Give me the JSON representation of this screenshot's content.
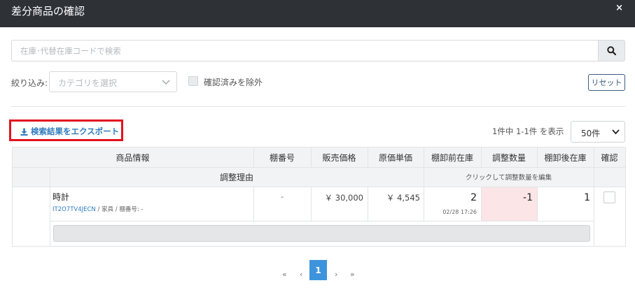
{
  "modal": {
    "title": "差分商品の確認",
    "close_label": "×"
  },
  "search": {
    "placeholder": "在庫･代替在庫コードで検索",
    "value": ""
  },
  "filter": {
    "label": "絞り込み:",
    "category_placeholder": "カテゴリを選択",
    "exclude_confirmed_label": "確認済みを除外",
    "reset_label": "リセット"
  },
  "export": {
    "label": "検索結果をエクスポート"
  },
  "results": {
    "count_text": "1件中 1-1件 を表示",
    "per_page": "50件"
  },
  "table": {
    "headers": {
      "product_info": "商品情報",
      "shelf_no": "棚番号",
      "sale_price": "販売価格",
      "unit_cost": "原価単価",
      "before_stock": "棚卸前在庫",
      "adjust_qty": "調整数量",
      "after_stock": "棚卸後在庫",
      "confirm": "確認",
      "adjust_reason": "調整理由",
      "adjust_hint": "クリックして調整数量を編集"
    },
    "rows": [
      {
        "name": "時計",
        "code": "IT2O7TV4JECN",
        "meta": "/ 家具 / 棚番号: -",
        "shelf": "-",
        "sale_price": "￥ 30,000",
        "unit_cost": "￥ 4,545",
        "before_stock": "2",
        "before_date": "02/28 17:26",
        "adjust_qty": "-1",
        "after_stock": "1",
        "confirmed": false,
        "reason": ""
      }
    ]
  },
  "pagination": {
    "first": "«",
    "prev": "‹",
    "current": "1",
    "next": "›",
    "last": "»"
  },
  "colors": {
    "header_bg": "#2e3237",
    "accent": "#3e94dc",
    "adjust_bg": "#fbe5e6",
    "highlight_border": "#e3121f"
  }
}
